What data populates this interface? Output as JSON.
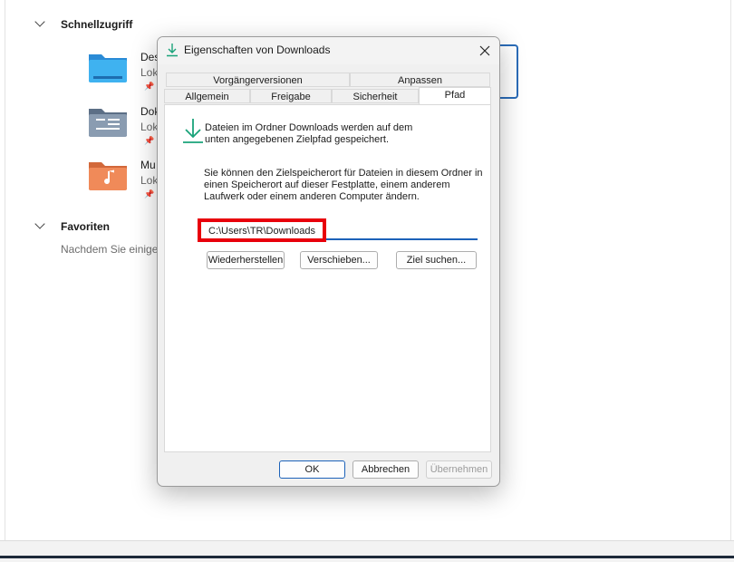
{
  "explorer": {
    "quick_access_header": "Schnellzugriff",
    "quick_access_items": [
      {
        "name": "Des",
        "sub": "Lok"
      },
      {
        "name": "Dok",
        "sub": "Lok"
      },
      {
        "name": "Mu",
        "sub": "Lok"
      }
    ],
    "favorites_header": "Favoriten",
    "favorites_hint": "Nachdem Sie einige"
  },
  "dialog": {
    "title": "Eigenschaften von Downloads",
    "tabs_row1": [
      "Vorgängerversionen",
      "Anpassen"
    ],
    "tabs_row2": [
      "Allgemein",
      "Freigabe",
      "Sicherheit",
      "Pfad"
    ],
    "active_tab": "Pfad",
    "description1": "Dateien im Ordner Downloads werden auf dem unten angegebenen Zielpfad gespeichert.",
    "description2": "Sie können den Zielspeicherort für Dateien in diesem Ordner in einen Speicherort auf dieser Festplatte, einem anderem Laufwerk oder einem anderen Computer ändern.",
    "path_value": "C:\\Users\\TR\\Downloads",
    "buttons": {
      "restore": "Wiederherstellen",
      "move": "Verschieben...",
      "find_target": "Ziel suchen...",
      "ok": "OK",
      "cancel": "Abbrechen",
      "apply": "Übernehmen"
    }
  },
  "colors": {
    "accent": "#1c62b9",
    "highlight": "#e8000b",
    "download_icon": "#1aa37a"
  }
}
